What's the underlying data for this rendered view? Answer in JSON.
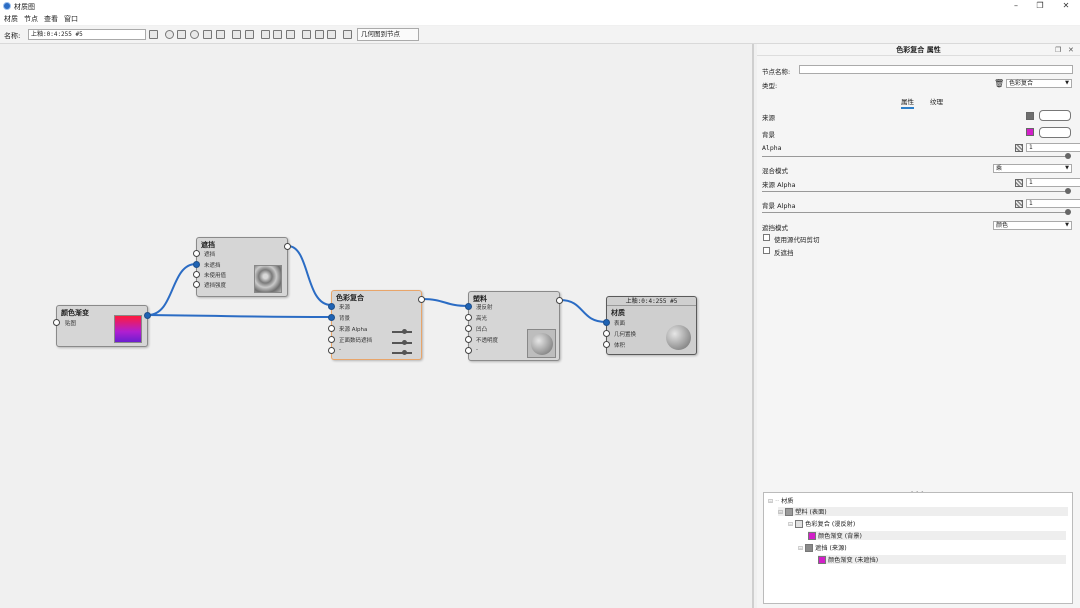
{
  "window": {
    "title": "材质图",
    "min_icon": "–",
    "max_icon": "❐",
    "close_icon": "✕"
  },
  "menu": [
    "材质",
    "节点",
    "查看",
    "窗口"
  ],
  "toolbar": {
    "name_label": "名称:",
    "name_value": "上釉:0:4:255 #5",
    "geometry_button": "几何图到节点"
  },
  "nodes": {
    "gradient": {
      "title": "颜色渐变",
      "ports": [
        "贴图"
      ]
    },
    "mask": {
      "title": "遮挡",
      "ports": [
        "遮挡",
        "未遮挡",
        "未使用值",
        "遮挡强度"
      ]
    },
    "blend": {
      "title": "色彩复合",
      "ports": [
        "来源",
        "背景",
        "来源 Alpha",
        "正面数码遮挡",
        "-"
      ]
    },
    "plastic": {
      "title": "塑料",
      "ports": [
        "漫反射",
        "高光",
        "凹凸",
        "不透明度",
        "-"
      ]
    },
    "material": {
      "header": "上釉:0:4:255 #5",
      "title": "材质",
      "ports": [
        "表面",
        "几何置换",
        "体积"
      ]
    }
  },
  "panel": {
    "title": "色彩复合 属性",
    "node_name_label": "节点名称:",
    "node_name_value": "",
    "type_label": "类型:",
    "type_value": "色彩复合",
    "tabs": [
      "属性",
      "纹理"
    ],
    "source_label": "来源",
    "background_label": "背景",
    "alpha_label": "Alpha",
    "alpha_value": "1",
    "blend_mode_label": "混合模式",
    "blend_mode_value": "乘",
    "source_alpha_label": "来源 Alpha",
    "source_alpha_value": "1",
    "bg_alpha_label": "背景 Alpha",
    "bg_alpha_value": "1",
    "mask_mode_label": "遮挡模式",
    "mask_mode_value": "颜色",
    "chk_use_code": "使用源代码剪切",
    "chk_invert": "反遮挡",
    "grip": "•••"
  },
  "tree": {
    "root": "材质",
    "items": [
      {
        "label": "塑料 (表面)"
      },
      {
        "label": "色彩复合 (漫反射)"
      },
      {
        "label": "颜色渐变 (背景)"
      },
      {
        "label": "遮挡 (来源)"
      },
      {
        "label": "颜色渐变 (未遮挡)"
      }
    ]
  },
  "colors": {
    "accent": "#1f63b4",
    "magenta": "#d21fc8",
    "wire": "#2b6cc4"
  }
}
